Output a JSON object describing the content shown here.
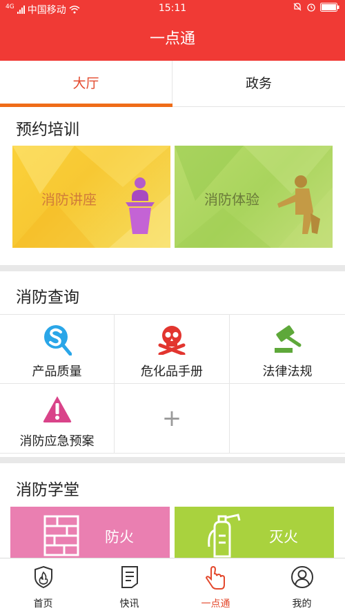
{
  "status_bar": {
    "carrier": "中国移动",
    "network": "4G",
    "time": "15:11"
  },
  "header": {
    "title": "一点通"
  },
  "tabs": [
    {
      "label": "大厅",
      "active": true
    },
    {
      "label": "政务",
      "active": false
    }
  ],
  "booking": {
    "title": "预约培训",
    "banners": [
      {
        "label": "消防讲座",
        "icon": "lecturer-podium-icon"
      },
      {
        "label": "消防体验",
        "icon": "cpr-training-icon"
      }
    ]
  },
  "query": {
    "title": "消防查询",
    "items": [
      {
        "label": "产品质量",
        "icon": "search-s-icon"
      },
      {
        "label": "危化品手册",
        "icon": "skull-crossbones-icon"
      },
      {
        "label": "法律法规",
        "icon": "gavel-icon"
      },
      {
        "label": "消防应急预案",
        "icon": "warning-triangle-icon"
      },
      {
        "label": "+",
        "icon": "add-icon"
      }
    ]
  },
  "school": {
    "title": "消防学堂",
    "cards": [
      {
        "label": "防火",
        "icon": "brick-wall-icon",
        "color": "#ea7fb1"
      },
      {
        "label": "灭火",
        "icon": "fire-extinguisher-icon",
        "color": "#a9d23e"
      }
    ]
  },
  "bottom_nav": [
    {
      "label": "首页",
      "icon": "fire-shield-icon",
      "active": false
    },
    {
      "label": "快讯",
      "icon": "news-document-icon",
      "active": false
    },
    {
      "label": "一点通",
      "icon": "touch-hand-icon",
      "active": true
    },
    {
      "label": "我的",
      "icon": "user-profile-icon",
      "active": false
    }
  ],
  "colors": {
    "brand_red": "#f03a35",
    "active_tab": "#e3482c",
    "tab_indicator": "#ef6c18"
  }
}
